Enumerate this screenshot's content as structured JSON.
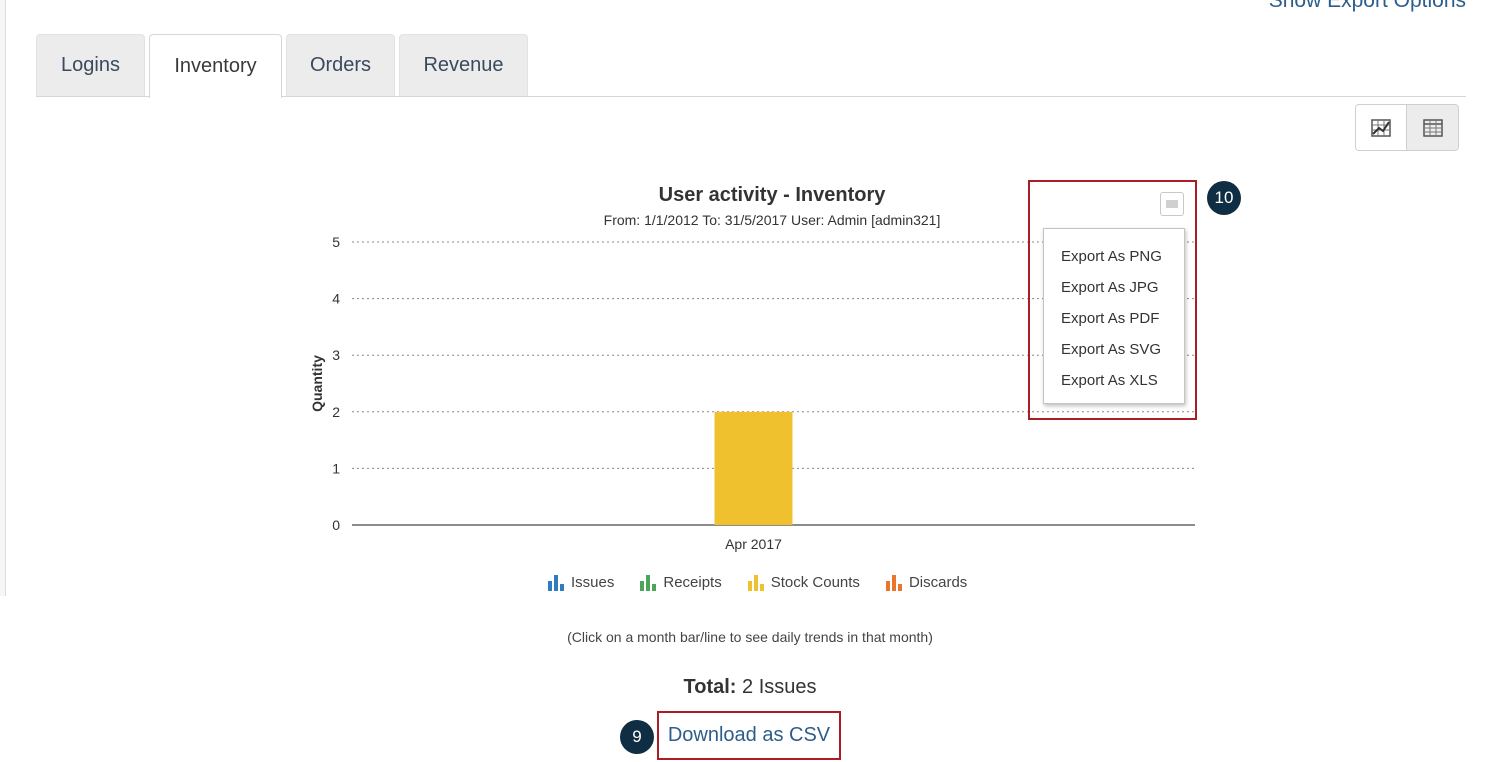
{
  "top_link": "Show Export Options",
  "tabs": [
    {
      "label": "Logins"
    },
    {
      "label": "Inventory"
    },
    {
      "label": "Orders"
    },
    {
      "label": "Revenue"
    }
  ],
  "active_tab": "Inventory",
  "view_toggle": {
    "chart_icon": "chart-icon",
    "table_icon": "table-icon",
    "active": "chart"
  },
  "chart_data": {
    "type": "bar",
    "title": "User activity - Inventory",
    "subtitle": "From: 1/1/2012 To: 31/5/2017 User: Admin [admin321]",
    "ylabel": "Quantity",
    "xlabel": "",
    "ylim": [
      0,
      5
    ],
    "yticks": [
      "0",
      "1",
      "2",
      "3",
      "4",
      "5"
    ],
    "categories": [
      "Apr 2017"
    ],
    "grid": true,
    "legend_position": "bottom",
    "series": [
      {
        "name": "Issues",
        "color": "#2e7bbf",
        "values": [
          0
        ]
      },
      {
        "name": "Receipts",
        "color": "#4ea55a",
        "values": [
          0
        ]
      },
      {
        "name": "Stock Counts",
        "color": "#f0c12f",
        "values": [
          2
        ]
      },
      {
        "name": "Discards",
        "color": "#e8762d",
        "values": [
          0
        ]
      }
    ]
  },
  "export_menu": {
    "items": [
      "Export As PNG",
      "Export As JPG",
      "Export As PDF",
      "Export As SVG",
      "Export As XLS"
    ]
  },
  "badges": {
    "export": "10",
    "csv": "9"
  },
  "hint": "(Click on a month bar/line to see daily trends in that month)",
  "total": {
    "label": "Total:",
    "value": "2 Issues"
  },
  "csv_link": "Download as CSV"
}
